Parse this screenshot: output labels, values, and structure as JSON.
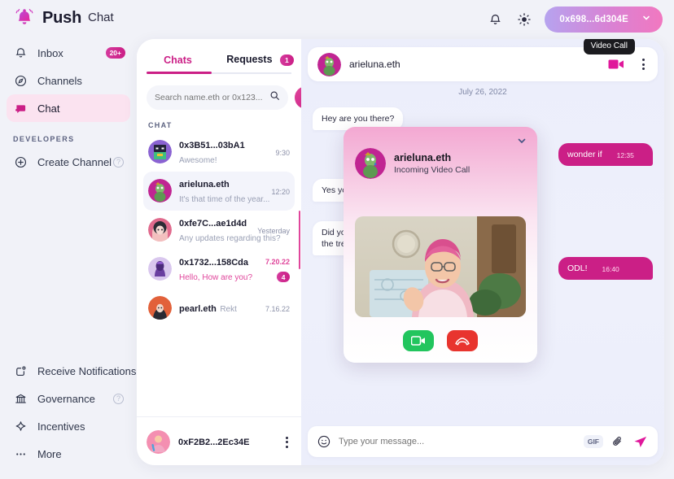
{
  "app": {
    "brand": "Push",
    "page_title": "Chat",
    "accent": "#cb1f86",
    "accent_light": "#e0469b"
  },
  "topbar": {
    "bell_icon": "bell-icon",
    "theme_icon": "sun-icon",
    "wallet_address": "0x698...6d304E",
    "wallet_chevron": "chevron-down-icon"
  },
  "sidebar": {
    "items": [
      {
        "label": "Inbox",
        "icon": "bell-icon",
        "badge": "20+",
        "active": false
      },
      {
        "label": "Channels",
        "icon": "compass-icon",
        "badge": "",
        "active": false
      },
      {
        "label": "Chat",
        "icon": "chat-bubble-icon",
        "badge": "",
        "active": true
      }
    ],
    "section_label": "DEVELOPERS",
    "dev_items": [
      {
        "label": "Create Channel",
        "icon": "plus-circle-icon",
        "help": "?"
      }
    ],
    "bottom_items": [
      {
        "label": "Receive Notifications",
        "icon": "notification-icon",
        "help": ""
      },
      {
        "label": "Governance",
        "icon": "bank-icon",
        "help": "?"
      },
      {
        "label": "Incentives",
        "icon": "sparkle-icon",
        "help": ""
      },
      {
        "label": "More",
        "icon": "ellipsis-icon",
        "help": ""
      }
    ]
  },
  "chat_list": {
    "tabs": [
      {
        "label": "Chats",
        "badge": "",
        "selected": true
      },
      {
        "label": "Requests",
        "badge": "1",
        "selected": false
      }
    ],
    "search": {
      "placeholder": "Search name.eth or 0x123...",
      "icon": "search-icon"
    },
    "add_button": "+",
    "section_label": "CHAT",
    "rows": [
      {
        "name": "0x3B51...03bA1",
        "preview": "Awesome!",
        "time": "9:30",
        "unread": "",
        "selected": false,
        "preview_pink": false,
        "time_pink": false
      },
      {
        "name": "arieluna.eth",
        "preview": "It's that time of the year...",
        "time": "12:20",
        "unread": "",
        "selected": true,
        "preview_pink": false,
        "time_pink": false
      },
      {
        "name": "0xfe7C...ae1d4d",
        "preview": "Any updates regarding this?",
        "time": "Yesterday",
        "unread": "",
        "selected": false,
        "preview_pink": false,
        "time_pink": false
      },
      {
        "name": "0x1732...158Cda",
        "preview": "Hello, How are you?",
        "time": "7.20.22",
        "unread": "4",
        "selected": false,
        "preview_pink": true,
        "time_pink": true
      },
      {
        "name": "pearl.eth",
        "preview": "Rekt",
        "time": "7.16.22",
        "unread": "",
        "selected": false,
        "preview_pink": false,
        "time_pink": false
      }
    ],
    "footer": {
      "name": "0xF2B2...2Ec34E",
      "menu_icon": "kebab-menu-icon"
    }
  },
  "conversation": {
    "header": {
      "name": "arieluna.eth",
      "video_icon": "video-camera-icon",
      "menu_icon": "kebab-menu-icon",
      "tooltip": "Video Call"
    },
    "date_separator": "July 26, 2022",
    "messages": [
      {
        "side": "left",
        "text": "Hey are you there?",
        "time": ""
      },
      {
        "side": "right",
        "text": "wonder if",
        "time": "12:35"
      },
      {
        "side": "left",
        "text": "Yes you can!",
        "time": ""
      },
      {
        "side": "left",
        "text": "Did you see the trend?",
        "time": ""
      },
      {
        "side": "right",
        "text": "ODL!",
        "time": "16:40"
      }
    ],
    "video_call": {
      "name": "arieluna.eth",
      "status": "Incoming Video Call",
      "collapse_icon": "chevron-down-icon",
      "accept_icon": "video-camera-icon",
      "decline_icon": "phone-hangup-icon",
      "accept_color": "#22c55e",
      "decline_color": "#e8342e"
    },
    "composer": {
      "emoji_icon": "smiley-icon",
      "placeholder": "Type your message...",
      "gif_label": "GIF",
      "attach_icon": "paperclip-icon",
      "send_icon": "send-icon"
    }
  }
}
